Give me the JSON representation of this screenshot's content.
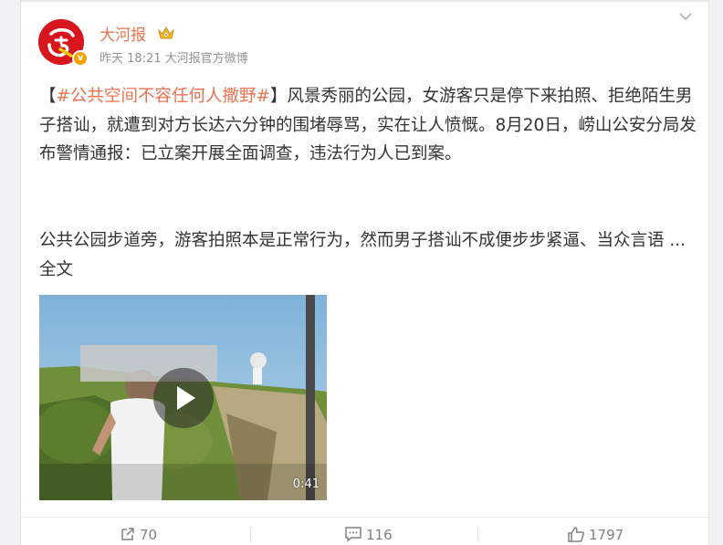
{
  "post": {
    "author": "大河报",
    "verified_badge": "v",
    "time": "昨天 18:21",
    "source": "大河报官方微博",
    "topic": "#公共空间不容任何人撒野#",
    "bracket_open": "【",
    "bracket_close": "】",
    "body_part1": "风景秀丽的公园，女游客只是停下来拍照、拒绝陌生男子搭讪，就遭到对方长达六分钟的围堵辱骂，实在让人愤慨。8月20日，崂山公安分局发布警情通报：已立案开展全面调查，违法行为人已到案。",
    "body_part2": "公共公园步道旁，游客拍照本是正常行为，然而男子搭讪不成便步步紧逼、当众言语 ...",
    "more_label": "全文",
    "video": {
      "duration": "0:41"
    }
  },
  "actions": {
    "repost_count": "70",
    "comment_count": "116",
    "like_count": "1797"
  },
  "colors": {
    "accent": "#eb7350",
    "brand_red": "#d7171d",
    "badge": "#f5a100"
  }
}
